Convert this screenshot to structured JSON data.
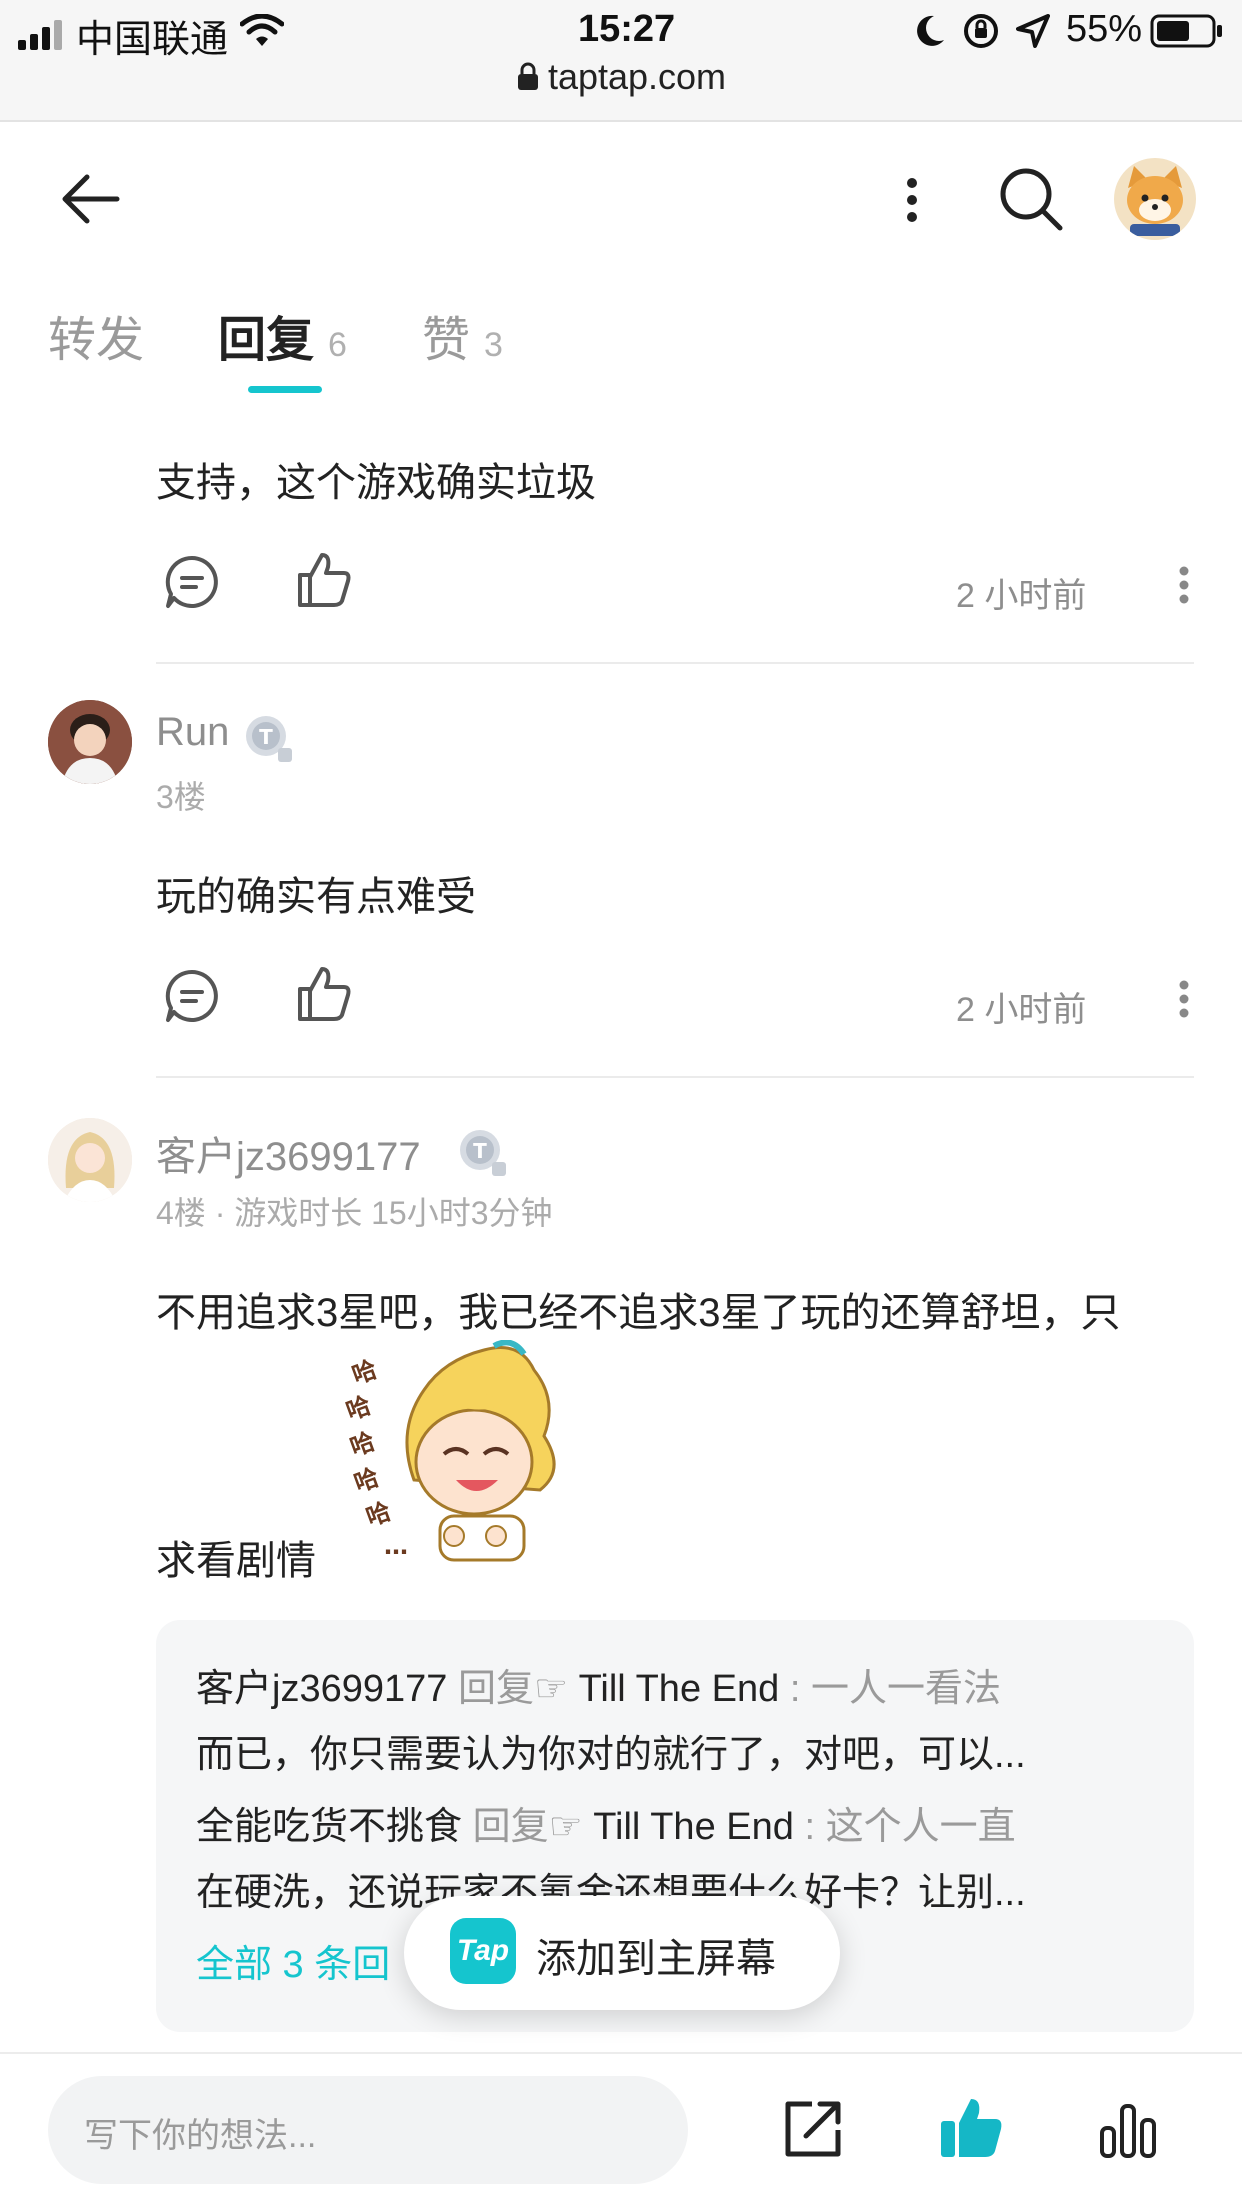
{
  "status_bar": {
    "carrier": "中国联通",
    "time": "15:27",
    "battery": "55%",
    "url": "taptap.com"
  },
  "tabs": [
    {
      "label": "转发",
      "count": ""
    },
    {
      "label": "回复",
      "count": "6"
    },
    {
      "label": "赞",
      "count": "3"
    }
  ],
  "comments": [
    {
      "text": "支持，这个游戏确实垃圾",
      "time": "2 小时前"
    },
    {
      "user": "Run",
      "badge": "T",
      "floor": "3楼",
      "text": "玩的确实有点难受",
      "time": "2 小时前"
    },
    {
      "user": "客户jz3699177",
      "badge": "T",
      "floor": "4楼 · 游戏时长 15小时3分钟",
      "text_line1": "不用追求3星吧，我已经不追求3星了玩的还算舒坦，只",
      "text_line2": "求看剧情"
    }
  ],
  "replies": [
    {
      "user": "客户jz3699177",
      "action": "回复",
      "target": "Till The End",
      "sep": ":",
      "line1": "一人一看法",
      "line2": "而已，你只需要认为你对的就行了，对吧，可以..."
    },
    {
      "user": "全能吃货不挑食",
      "action": "回复",
      "target": "Till The End",
      "sep": ":",
      "line1": "这个人一直",
      "line2": "在硬洗，还说玩家不氪金还想要什么好卡？让别..."
    }
  ],
  "replies_more": "全部 3 条回",
  "toast": {
    "logo": "Tap",
    "label": "添加到主屏幕"
  },
  "bottom_bar": {
    "placeholder": "写下你的想法..."
  },
  "colors": {
    "accent": "#15c5ce",
    "like_active": "#15b7c6"
  }
}
